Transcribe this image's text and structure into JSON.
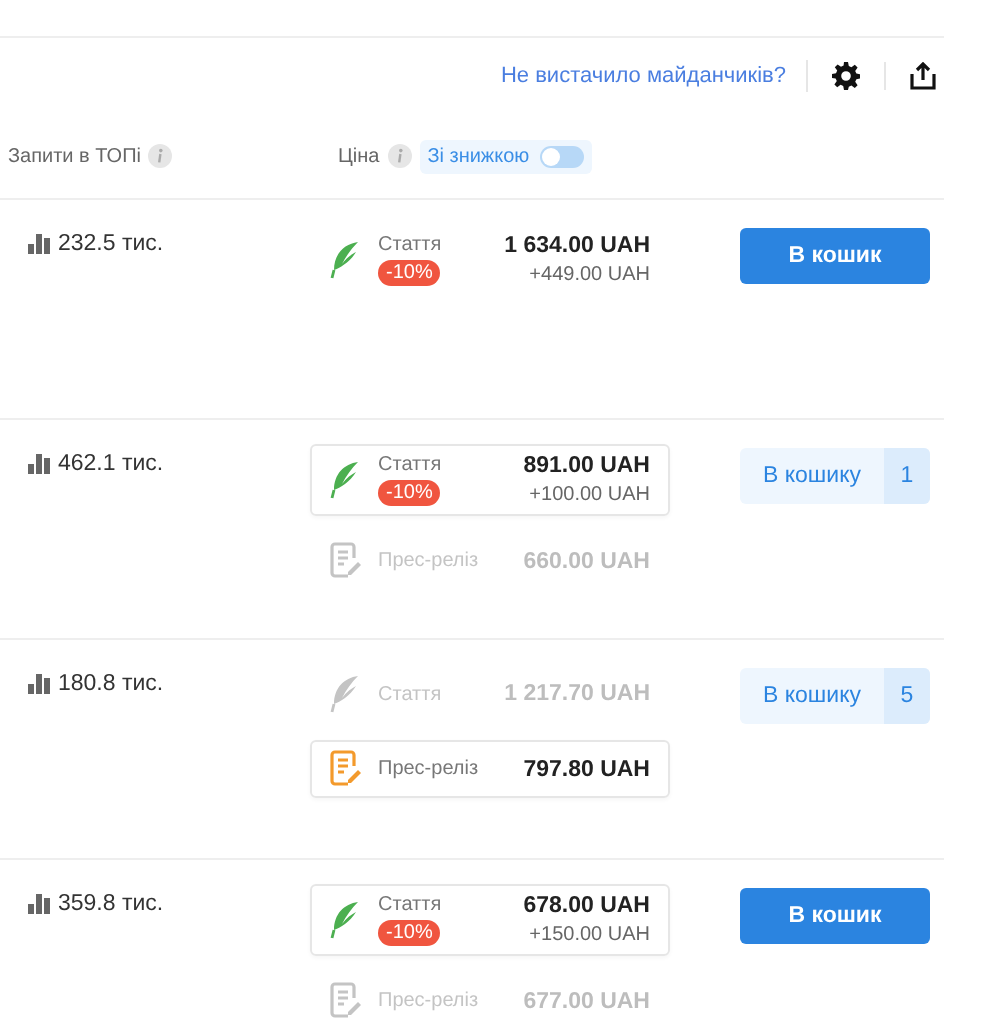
{
  "toolbar": {
    "link": "Не вистачило майданчиків?"
  },
  "columns": {
    "queries": "Запити в ТОПі",
    "price": "Ціна",
    "discount_toggle": {
      "label": "Зі знижкою",
      "on": false
    }
  },
  "rows": [
    {
      "queries": "232.5 тис.",
      "offers": [
        {
          "kind": "article",
          "label": "Стаття",
          "discount": "-10%",
          "price": "1 634.00 UAH",
          "extra": "+449.00 UAH",
          "selected": false,
          "disabled": false
        }
      ],
      "cart": {
        "label": "В кошик",
        "in_cart": false
      }
    },
    {
      "queries": "462.1 тис.",
      "offers": [
        {
          "kind": "article",
          "label": "Стаття",
          "discount": "-10%",
          "price": "891.00 UAH",
          "extra": "+100.00 UAH",
          "selected": true,
          "disabled": false
        },
        {
          "kind": "press",
          "label": "Прес-реліз",
          "price": "660.00 UAH",
          "selected": false,
          "disabled": true
        }
      ],
      "cart": {
        "label": "В кошику",
        "count": "1",
        "in_cart": true
      }
    },
    {
      "queries": "180.8 тис.",
      "offers": [
        {
          "kind": "article",
          "label": "Стаття",
          "price": "1 217.70 UAH",
          "selected": false,
          "disabled": true
        },
        {
          "kind": "press",
          "label": "Прес-реліз",
          "price": "797.80 UAH",
          "selected": true,
          "disabled": false
        }
      ],
      "cart": {
        "label": "В кошику",
        "count": "5",
        "in_cart": true
      }
    },
    {
      "queries": "359.8 тис.",
      "offers": [
        {
          "kind": "article",
          "label": "Стаття",
          "discount": "-10%",
          "price": "678.00 UAH",
          "extra": "+150.00 UAH",
          "selected": true,
          "disabled": false
        },
        {
          "kind": "press",
          "label": "Прес-реліз",
          "price": "677.00 UAH",
          "selected": false,
          "disabled": true
        }
      ],
      "cart": {
        "label": "В кошик",
        "in_cart": false
      }
    }
  ]
}
